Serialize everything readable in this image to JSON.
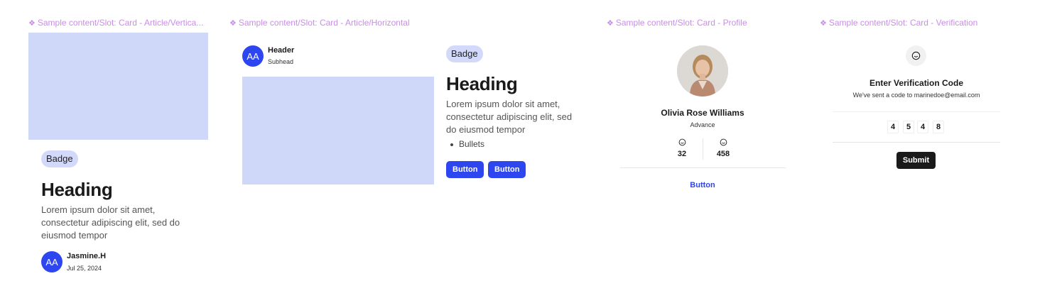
{
  "slots": {
    "vertical": "Sample content/Slot: Card - Article/Vertica...",
    "horizontal": "Sample content/Slot: Card - Article/Horizontal",
    "profile": "Sample content/Slot: Card - Profile",
    "verification": "Sample content/Slot: Card - Verification",
    "marker": "❖"
  },
  "article_vertical": {
    "badge": "Badge",
    "heading": "Heading",
    "body": "Lorem ipsum dolor sit amet, consectetur adipiscing elit, sed do eiusmod tempor",
    "avatar_initials": "AA",
    "author": "Jasmine.H",
    "date": "Jul 25, 2024"
  },
  "article_horizontal": {
    "avatar_initials": "AA",
    "header": "Header",
    "subhead": "Subhead",
    "badge": "Badge",
    "heading": "Heading",
    "body": "Lorem ipsum dolor sit amet, consectetur adipiscing elit, sed do eiusmod tempor",
    "bullet": "Bullets",
    "button_1": "Button",
    "button_2": "Button"
  },
  "profile": {
    "name": "Olivia Rose Williams",
    "level": "Advance",
    "stats": [
      "32",
      "458"
    ],
    "button": "Button"
  },
  "verification": {
    "title": "Enter Verification Code",
    "subtitle": "We've sent a code to marinedoe@email.com",
    "digits": [
      "4",
      "5",
      "4",
      "8"
    ],
    "submit": "Submit"
  },
  "colors": {
    "accent": "#2d46f0",
    "placeholder": "#d0d8fa",
    "badge_bg": "#d3d9fa",
    "slot_label": "#c88ee6",
    "submit_bg": "#1a1a1a"
  },
  "icons": {
    "slot_marker": "component-diamond-icon",
    "stat": "smile-icon",
    "verification": "smile-icon"
  }
}
